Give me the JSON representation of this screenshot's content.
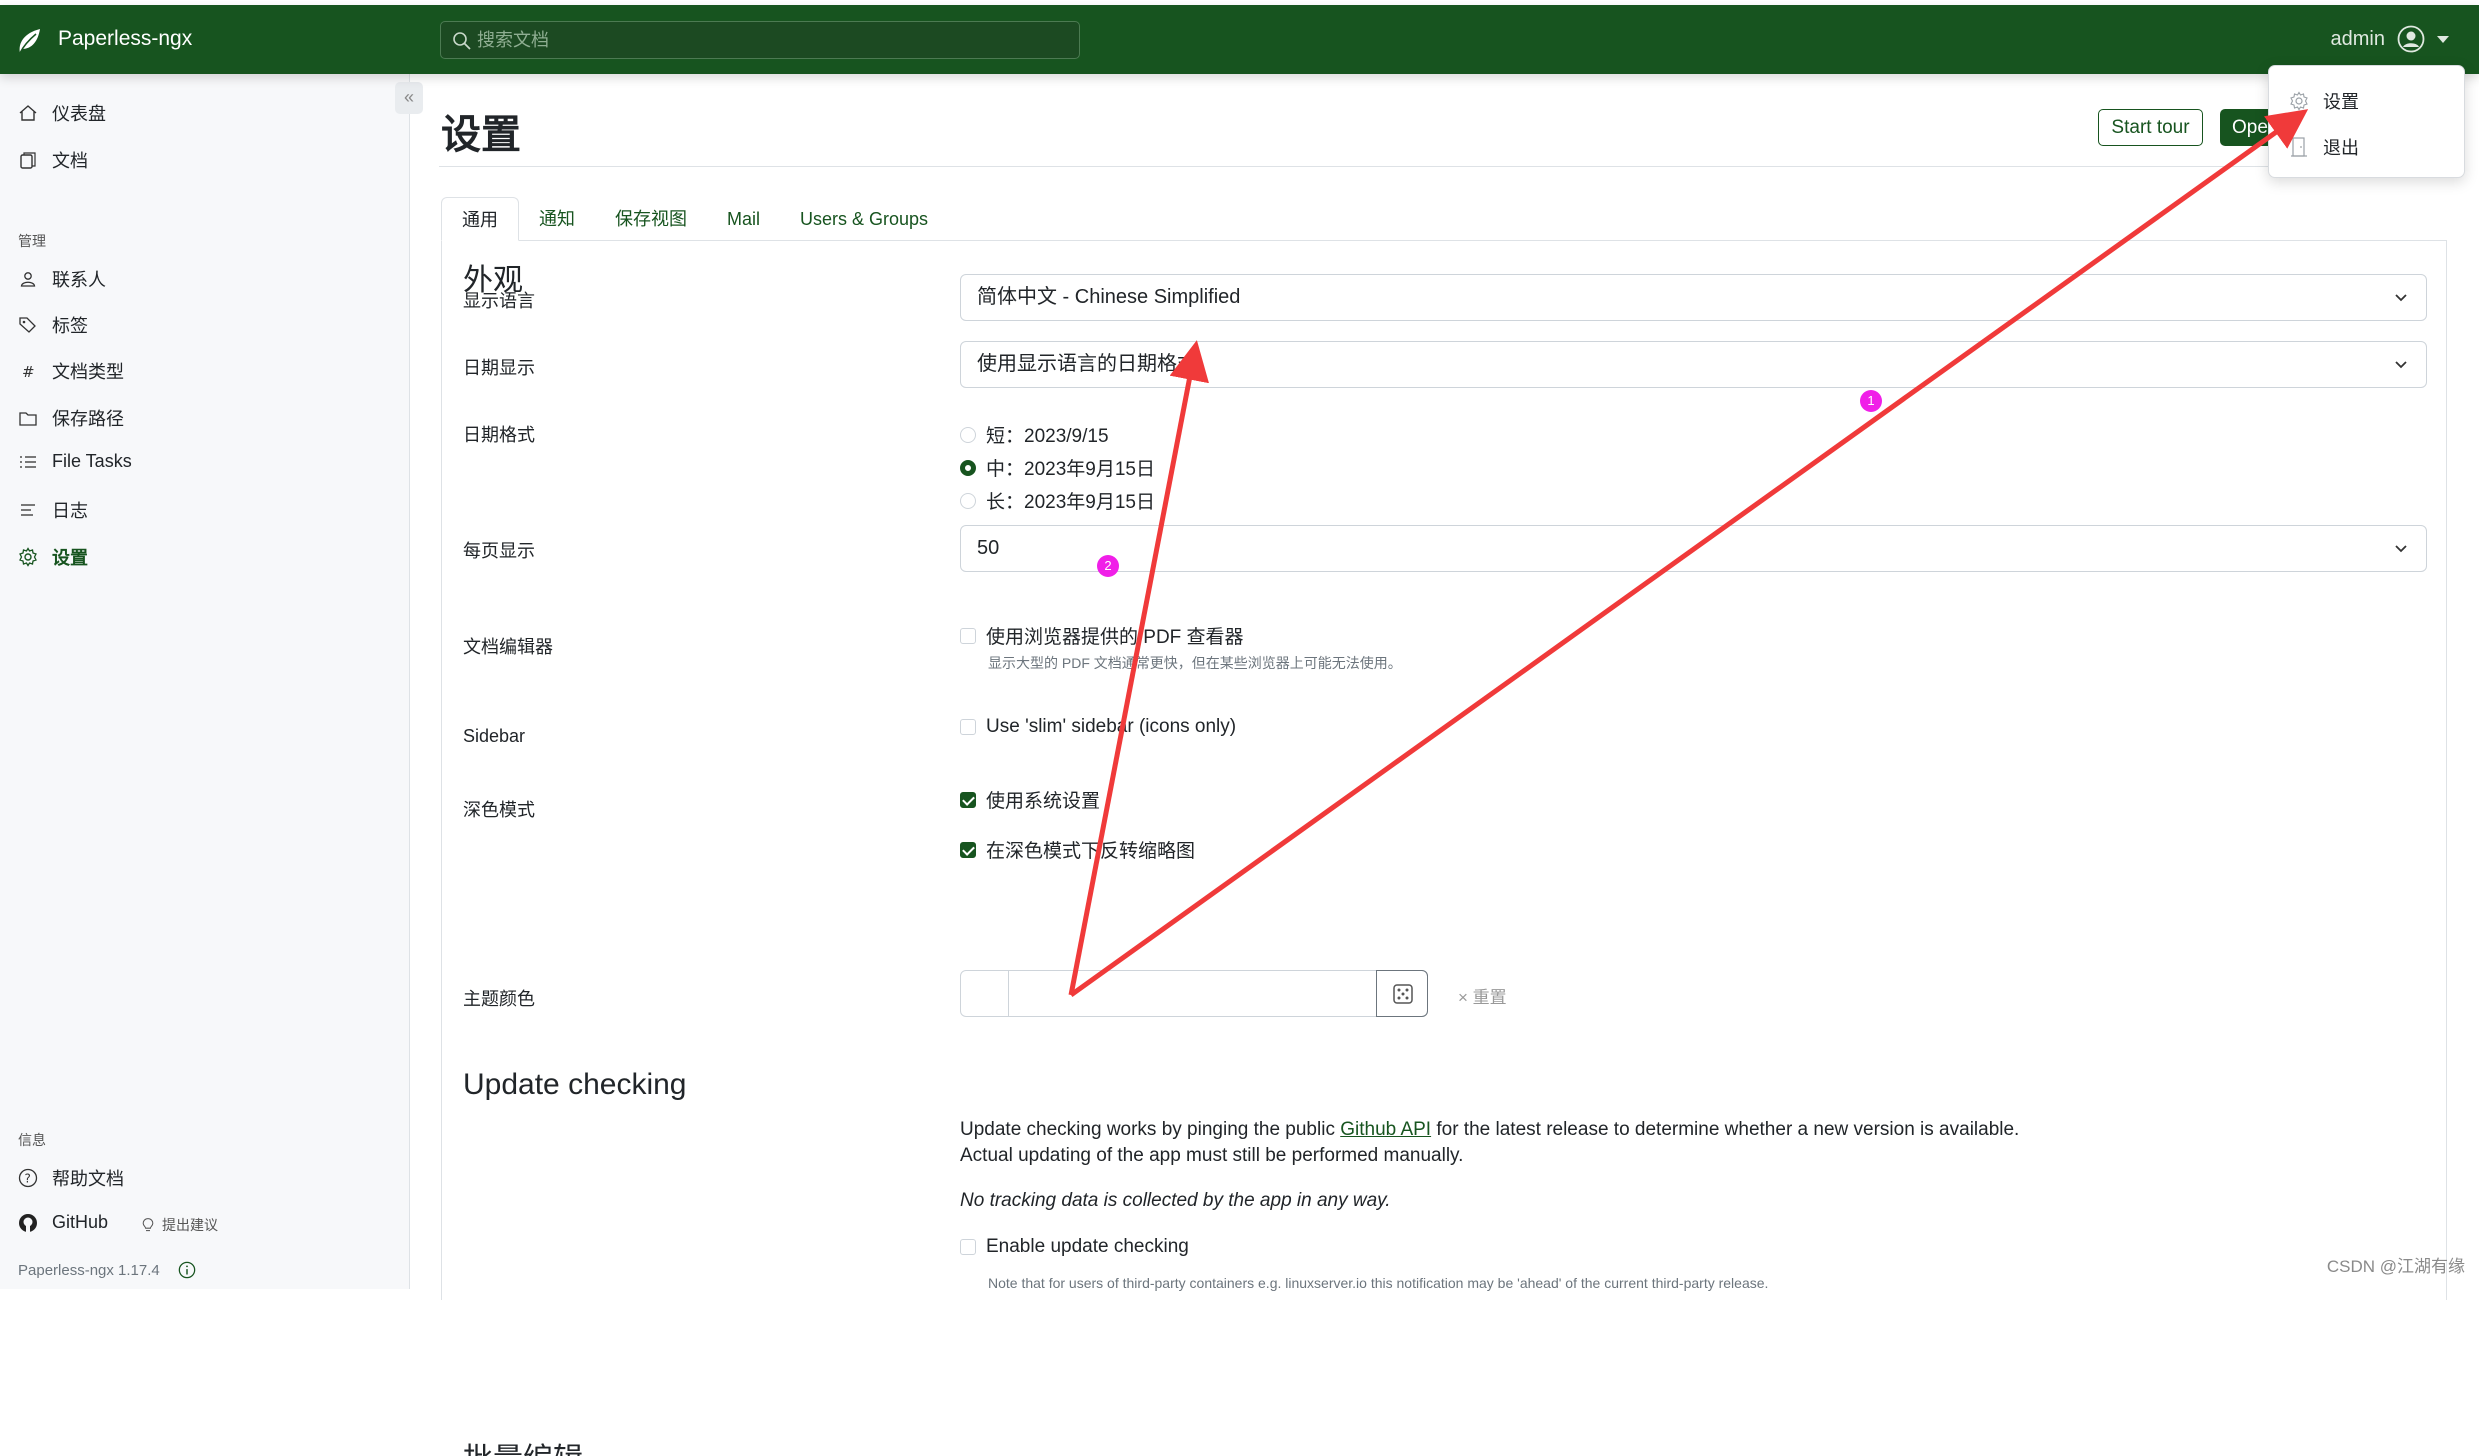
{
  "app": {
    "brand": "Paperless-ngx",
    "search_placeholder": "搜索文档",
    "user": "admin"
  },
  "user_menu": {
    "items": [
      {
        "label": "设置",
        "icon": "gear-icon"
      },
      {
        "label": "退出",
        "icon": "door-icon"
      }
    ]
  },
  "sidebar": {
    "main_items": [
      {
        "label": "仪表盘",
        "icon": "house-icon"
      },
      {
        "label": "文档",
        "icon": "files-icon"
      }
    ],
    "manage_heading": "管理",
    "manage_items": [
      {
        "label": "联系人",
        "icon": "person-icon"
      },
      {
        "label": "标签",
        "icon": "tags-icon"
      },
      {
        "label": "文档类型",
        "icon": "hash-icon"
      },
      {
        "label": "保存路径",
        "icon": "folder-icon"
      },
      {
        "label": "File Tasks",
        "icon": "list-task-icon"
      },
      {
        "label": "日志",
        "icon": "text-left-icon"
      },
      {
        "label": "设置",
        "icon": "gear-icon",
        "active": true
      }
    ],
    "info_heading": "信息",
    "help_label": "帮助文档",
    "github_label": "GitHub",
    "suggest_label": "提出建议",
    "version": "Paperless-ngx 1.17.4",
    "collapse_glyph": "«"
  },
  "page": {
    "title": "设置",
    "start_tour": "Start tour",
    "open_button": "Ope",
    "tabs": [
      {
        "label": "通用",
        "active": true
      },
      {
        "label": "通知"
      },
      {
        "label": "保存视图"
      },
      {
        "label": "Mail"
      },
      {
        "label": "Users & Groups"
      }
    ]
  },
  "appearance": {
    "title": "外观",
    "language_label": "显示语言",
    "language_value": "简体中文 - Chinese Simplified",
    "date_display_label": "日期显示",
    "date_display_value": "使用显示语言的日期格式",
    "date_format_label": "日期格式",
    "date_formats": [
      {
        "label": "短：2023/9/15",
        "checked": false
      },
      {
        "label": "中：2023年9月15日",
        "checked": true
      },
      {
        "label": "长：2023年9月15日",
        "checked": false
      }
    ],
    "page_size_label": "每页显示",
    "page_size_value": "50",
    "doc_editor_label": "文档编辑器",
    "pdf_viewer_option": "使用浏览器提供的 PDF 查看器",
    "pdf_viewer_checked": false,
    "pdf_viewer_hint": "显示大型的 PDF 文档通常更快，但在某些浏览器上可能无法使用。",
    "sidebar_label": "Sidebar",
    "slim_sidebar_option": "Use 'slim' sidebar (icons only)",
    "slim_sidebar_checked": false,
    "dark_mode_label": "深色模式",
    "dark_system_option": "使用系统设置",
    "dark_system_checked": true,
    "dark_invert_option": "在深色模式下反转缩略图",
    "dark_invert_checked": true,
    "theme_color_label": "主题颜色",
    "theme_color_value": "",
    "reset_label": "重置"
  },
  "update_checking": {
    "title": "Update checking",
    "text_before_link": "Update checking works by pinging the public ",
    "link_text": "Github API",
    "text_after_link": " for the latest release to determine whether a new version is available.",
    "line2": "Actual updating of the app must still be performed manually.",
    "no_tracking": "No tracking data is collected by the app in any way.",
    "enable_option": "Enable update checking",
    "enable_checked": false,
    "note": "Note that for users of third-party containers e.g. linuxserver.io this notification may be 'ahead' of the current third-party release."
  },
  "next_section_title": "批量编辑",
  "annotations": {
    "markers": [
      "1",
      "2"
    ],
    "arrow_color": "#f03a3a",
    "marker_color": "#f01fe8"
  },
  "watermark": "CSDN @江湖有缘",
  "colors": {
    "primary": "#17541f",
    "sidebar_bg": "#f7f8fa"
  }
}
